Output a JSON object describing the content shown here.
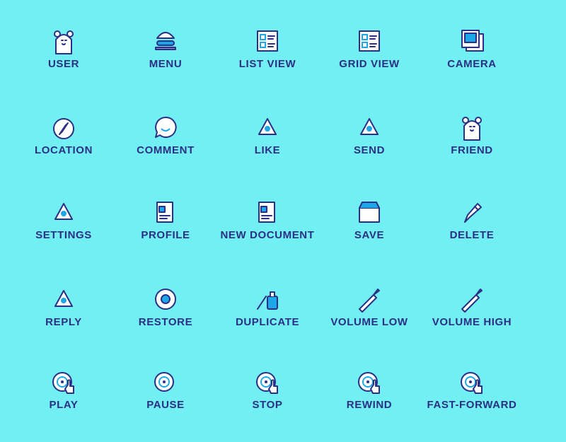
{
  "colors": {
    "background": "#72EFF3",
    "ink": "#2B2F85",
    "fill": "#FFFFFF",
    "accent": "#1EA7E8"
  },
  "icons": [
    {
      "label": "USER",
      "icon": "bear-icon"
    },
    {
      "label": "MENU",
      "icon": "burger-icon"
    },
    {
      "label": "LIST VIEW",
      "icon": "list-view-icon"
    },
    {
      "label": "GRID VIEW",
      "icon": "grid-view-icon"
    },
    {
      "label": "CAMERA",
      "icon": "photo-icon"
    },
    {
      "label": "LOCATION",
      "icon": "compass-icon"
    },
    {
      "label": "COMMENT",
      "icon": "speech-bubble-icon"
    },
    {
      "label": "LIKE",
      "icon": "rock-hand-icon"
    },
    {
      "label": "SEND",
      "icon": "paper-bird-icon"
    },
    {
      "label": "FRIEND",
      "icon": "bear-wink-icon"
    },
    {
      "label": "SETTINGS",
      "icon": "pointing-hand-icon"
    },
    {
      "label": "PROFILE",
      "icon": "id-card-icon"
    },
    {
      "label": "NEW DOCUMENT",
      "icon": "notebook-pen-icon"
    },
    {
      "label": "SAVE",
      "icon": "box-icon"
    },
    {
      "label": "DELETE",
      "icon": "pencil-icon"
    },
    {
      "label": "REPLY",
      "icon": "bottle-message-icon"
    },
    {
      "label": "RESTORE",
      "icon": "lifebuoy-icon"
    },
    {
      "label": "DUPLICATE",
      "icon": "glue-brush-icon"
    },
    {
      "label": "VOLUME LOW",
      "icon": "trumpet-icon"
    },
    {
      "label": "VOLUME HIGH",
      "icon": "trumpet-loud-icon"
    },
    {
      "label": "PLAY",
      "icon": "disc-hand-icon"
    },
    {
      "label": "PAUSE",
      "icon": "disc-icon"
    },
    {
      "label": "STOP",
      "icon": "disc-hold-icon"
    },
    {
      "label": "REWIND",
      "icon": "disc-rewind-icon"
    },
    {
      "label": "FAST-FORWARD",
      "icon": "disc-forward-icon"
    }
  ]
}
